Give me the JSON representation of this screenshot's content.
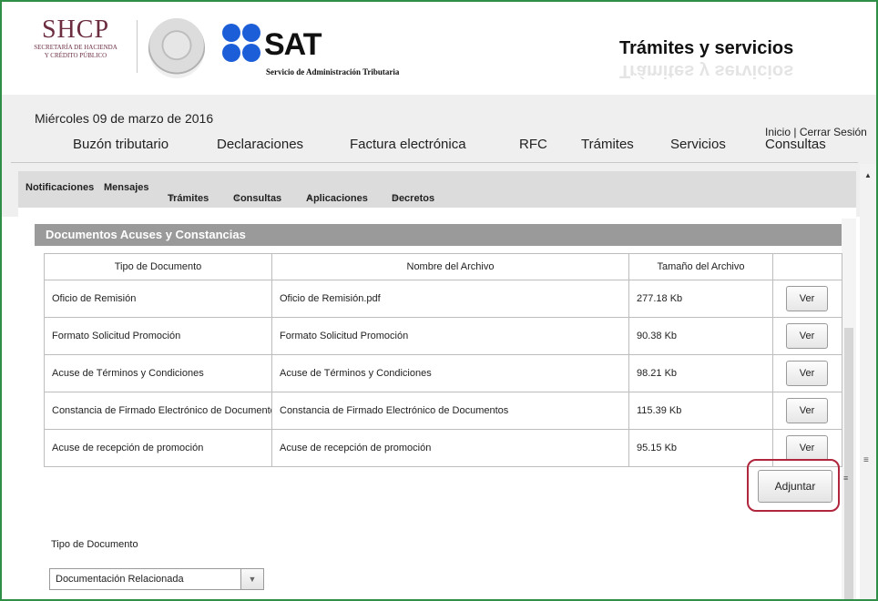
{
  "header": {
    "shcp_logo_text": "SHCP",
    "shcp_logo_subtext_1": "SECRETARÍA DE HACIENDA",
    "shcp_logo_subtext_2": "Y CRÉDITO PÚBLICO",
    "sat_logo_text": "SAT",
    "sat_subtitle": "Servicio de Administración Tributaria",
    "section_title": "Trámites y servicios"
  },
  "topbar": {
    "date": "Miércoles 09 de marzo de 2016",
    "inicio": "Inicio",
    "separator": "|",
    "cerrar_sesion": "Cerrar Sesión"
  },
  "main_nav": [
    "Buzón tributario",
    "Declaraciones",
    "Factura electrónica",
    "RFC",
    "Trámites",
    "Servicios",
    "Consultas"
  ],
  "sub_nav": {
    "notificaciones": "Notificaciones",
    "mensajes": "Mensajes",
    "tramites": "Trámites",
    "consultas": "Consultas",
    "aplicaciones": "Aplicaciones",
    "decretos": "Decretos"
  },
  "panel": {
    "title": "Documentos Acuses y Constancias",
    "columns": [
      "Tipo de Documento",
      "Nombre del Archivo",
      "Tamaño del Archivo",
      ""
    ],
    "rows": [
      {
        "tipo": "Oficio de Remisión",
        "nombre": "Oficio de Remisión.pdf",
        "tamano": "277.18 Kb",
        "action": "Ver"
      },
      {
        "tipo": "Formato Solicitud Promoción",
        "nombre": "Formato Solicitud Promoción",
        "tamano": "90.38 Kb",
        "action": "Ver"
      },
      {
        "tipo": "Acuse de Términos y Condiciones",
        "nombre": "Acuse de Términos y Condiciones",
        "tamano": "98.21 Kb",
        "action": "Ver"
      },
      {
        "tipo": "Constancia de Firmado Electrónico de Documentos",
        "nombre": "Constancia de Firmado Electrónico de Documentos",
        "tamano": "115.39 Kb",
        "action": "Ver"
      },
      {
        "tipo": "Acuse de recepción de promoción",
        "nombre": "Acuse de recepción de promoción",
        "tamano": "95.15 Kb",
        "action": "Ver"
      }
    ],
    "attach_button": "Adjuntar"
  },
  "form": {
    "tipo_label": "Tipo de Documento",
    "tipo_selected": "Documentación Relacionada"
  },
  "colors": {
    "frame_border": "#2f8f46",
    "sat_blue": "#1c5ed8",
    "shcp_maroon": "#6b2d3f",
    "highlight": "#b0263d",
    "panel_header": "#9a9a9a"
  }
}
